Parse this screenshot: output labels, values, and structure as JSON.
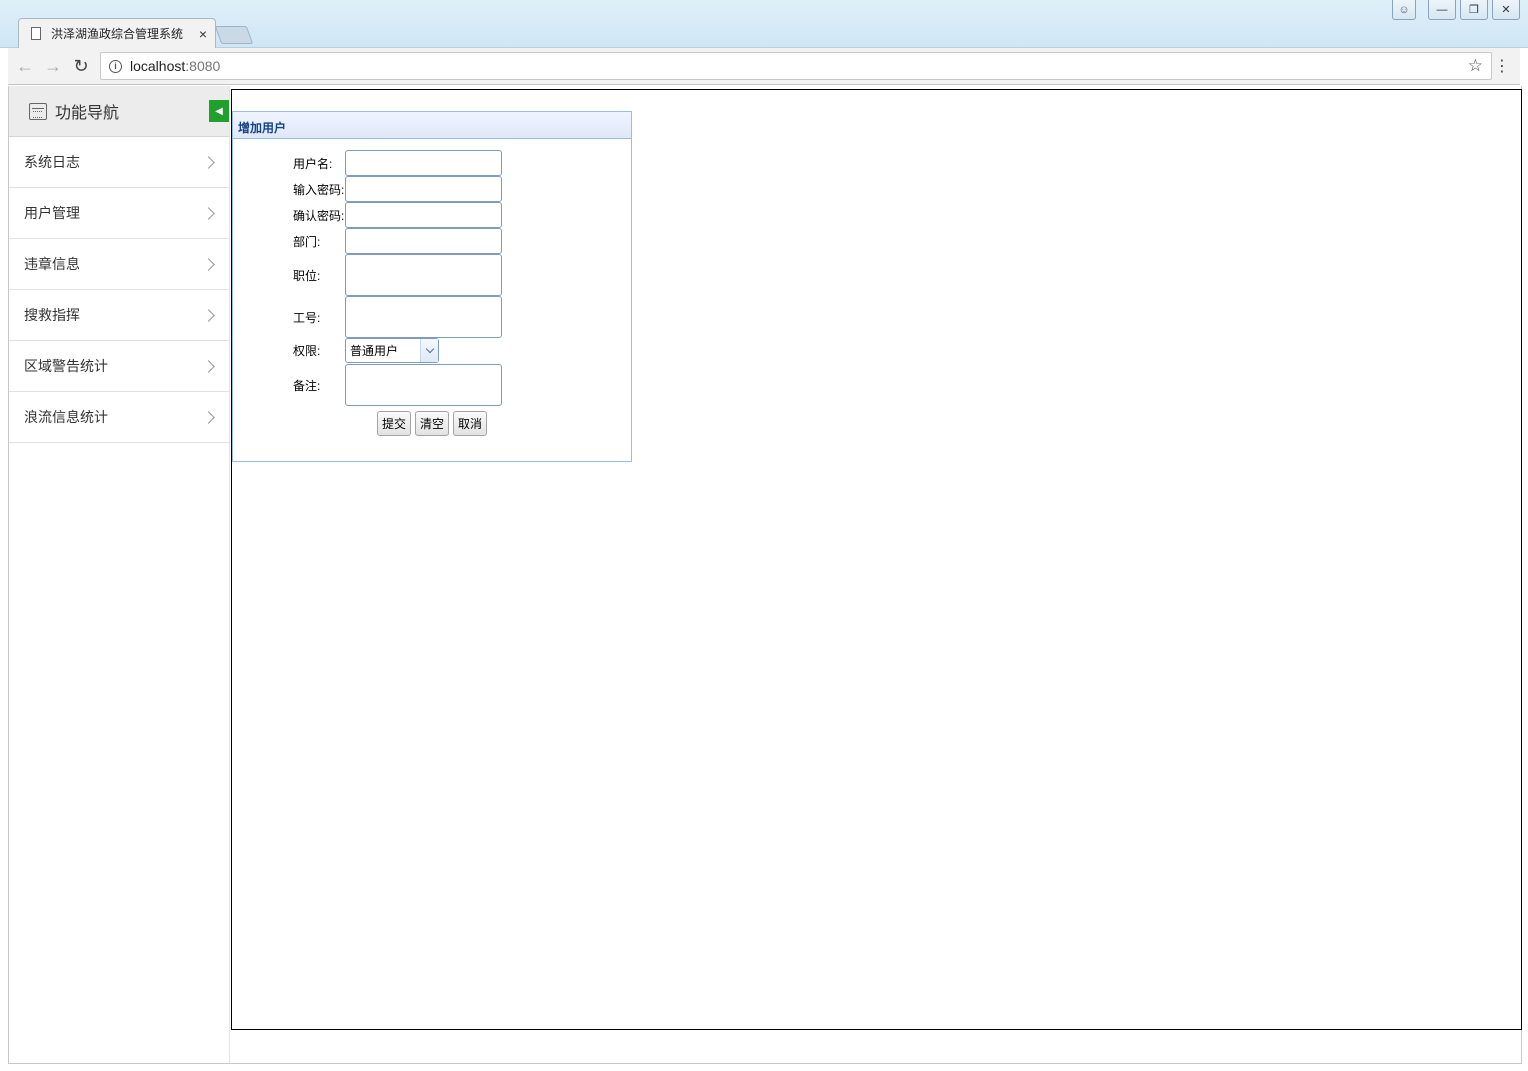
{
  "browser": {
    "tab_title": "洪泽湖渔政综合管理系统",
    "tab_close": "×",
    "url_host": "localhost",
    "url_port": ":8080"
  },
  "sidebar": {
    "title": "功能导航",
    "items": [
      {
        "label": "系统日志"
      },
      {
        "label": "用户管理"
      },
      {
        "label": "违章信息"
      },
      {
        "label": "搜救指挥"
      },
      {
        "label": "区域警告统计"
      },
      {
        "label": "浪流信息统计"
      }
    ]
  },
  "panel": {
    "title": "增加用户",
    "fields": {
      "username_label": "用户名:",
      "password_label": "输入密码:",
      "confirm_label": "确认密码:",
      "dept_label": "部门:",
      "position_label": "职位:",
      "jobno_label": "工号:",
      "perm_label": "权限:",
      "perm_value": "普通用户",
      "note_label": "备注:"
    },
    "buttons": {
      "submit": "提交",
      "clear": "清空",
      "cancel": "取消"
    }
  },
  "colors": {
    "nav_toggle": "#21a02e",
    "panel_header_text": "#15428b",
    "panel_border": "#99bbe8"
  }
}
